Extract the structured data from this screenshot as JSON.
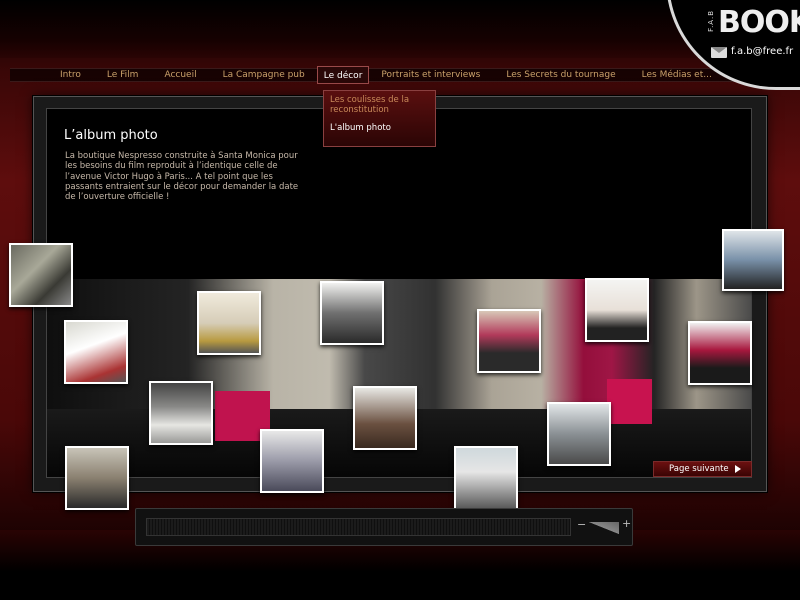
{
  "nav": {
    "items": [
      "Intro",
      "Le Film",
      "Accueil",
      "La Campagne pub",
      "Le décor",
      "Portraits et interviews",
      "Les Secrets du tournage",
      "Les Médias et..."
    ],
    "active_index": 4
  },
  "dropdown": {
    "items": [
      "Les coulisses de la reconstitution",
      "L'album photo"
    ]
  },
  "brand": {
    "small": "F.A.B",
    "big": "BOOK",
    "email": "f.a.b@free.fr"
  },
  "content": {
    "title": "L’album photo",
    "description": "La boutique Nespresso construite à Santa Monica pour les besoins du film reproduit à l’identique celle de l’avenue Victor Hugo à Paris... A tel point que les passants entraient sur le décor pour demander la date de l’ouverture officielle !"
  },
  "next_button": "Page suivante",
  "player": {
    "minus": "−",
    "plus": "+"
  },
  "colors": {
    "accent": "#c0134e",
    "nav_text": "#c9a06a",
    "bg_red": "#5e0d0d"
  }
}
